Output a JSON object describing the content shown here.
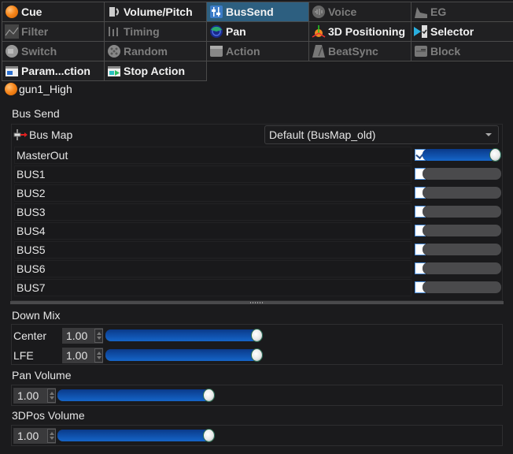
{
  "tabs": [
    {
      "label": "Cue",
      "icon": "orange-ball-icon",
      "state": "enabled"
    },
    {
      "label": "Volume/Pitch",
      "icon": "speaker-icon",
      "state": "enabled"
    },
    {
      "label": "BusSend",
      "icon": "bus-fader-icon",
      "state": "active"
    },
    {
      "label": "Voice",
      "icon": "voice-icon",
      "state": "disabled"
    },
    {
      "label": "EG",
      "icon": "envelope-icon",
      "state": "disabled"
    },
    {
      "label": "Filter",
      "icon": "filter-curve-icon",
      "state": "disabled"
    },
    {
      "label": "Timing",
      "icon": "timing-icon",
      "state": "disabled"
    },
    {
      "label": "Pan",
      "icon": "pan-radar-icon",
      "state": "enabled"
    },
    {
      "label": "3D Positioning",
      "icon": "3d-axes-icon",
      "state": "enabled"
    },
    {
      "label": "Selector",
      "icon": "selector-icon",
      "state": "enabled"
    },
    {
      "label": "Switch",
      "icon": "switch-icon",
      "state": "disabled"
    },
    {
      "label": "Random",
      "icon": "random-dice-icon",
      "state": "disabled"
    },
    {
      "label": "Action",
      "icon": "clapperboard-icon",
      "state": "disabled"
    },
    {
      "label": "BeatSync",
      "icon": "metronome-icon",
      "state": "disabled"
    },
    {
      "label": "Block",
      "icon": "block-icon",
      "state": "disabled"
    },
    {
      "label": "Param...ction",
      "icon": "param-action-icon",
      "state": "enabled"
    },
    {
      "label": "Stop Action",
      "icon": "stop-action-icon",
      "state": "enabled"
    }
  ],
  "cue_name": "gun1_High",
  "bus_send": {
    "section_label": "Bus Send",
    "bus_map_label": "Bus Map",
    "bus_map_value": "Default (BusMap_old)",
    "buses": [
      {
        "name": "MasterOut",
        "checked": true,
        "level": 1.0
      },
      {
        "name": "BUS1",
        "checked": false,
        "level": 0.0
      },
      {
        "name": "BUS2",
        "checked": false,
        "level": 0.0
      },
      {
        "name": "BUS3",
        "checked": false,
        "level": 0.0
      },
      {
        "name": "BUS4",
        "checked": false,
        "level": 0.0
      },
      {
        "name": "BUS5",
        "checked": false,
        "level": 0.0
      },
      {
        "name": "BUS6",
        "checked": false,
        "level": 0.0
      },
      {
        "name": "BUS7",
        "checked": false,
        "level": 0.0
      }
    ]
  },
  "down_mix": {
    "section_label": "Down Mix",
    "center": {
      "label": "Center",
      "value": "1.00",
      "level": 1.0
    },
    "lfe": {
      "label": "LFE",
      "value": "1.00",
      "level": 1.0
    }
  },
  "pan_volume": {
    "section_label": "Pan Volume",
    "value": "1.00",
    "level": 1.0
  },
  "pos3d_volume": {
    "section_label": "3DPos Volume",
    "value": "1.00",
    "level": 1.0
  },
  "colors": {
    "active_tab": "#2d5f80",
    "slider_fill": "#1565c8",
    "accent_orange": "#f7871c"
  }
}
